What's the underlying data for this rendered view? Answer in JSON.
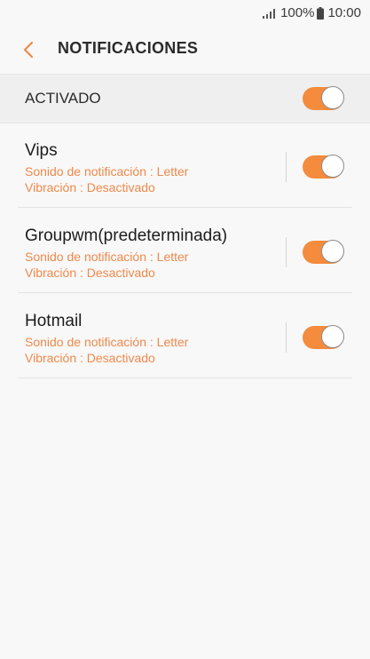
{
  "status_bar": {
    "battery": "100%",
    "time": "10:00"
  },
  "header": {
    "title": "NOTIFICACIONES"
  },
  "master": {
    "label": "ACTIVADO",
    "enabled": true
  },
  "apps": [
    {
      "name": "Vips",
      "sound": "Sonido de notificación : Letter",
      "vibration": "Vibración : Desactivado",
      "enabled": true
    },
    {
      "name": "Groupwm(predeterminada)",
      "sound": "Sonido de notificación : Letter",
      "vibration": "Vibración : Desactivado",
      "enabled": true
    },
    {
      "name": "Hotmail",
      "sound": "Sonido de notificación : Letter",
      "vibration": "Vibración : Desactivado",
      "enabled": true
    }
  ],
  "colors": {
    "accent": "#f58b3c",
    "subtext": "#f0894a",
    "background": "#f8f8f8"
  }
}
